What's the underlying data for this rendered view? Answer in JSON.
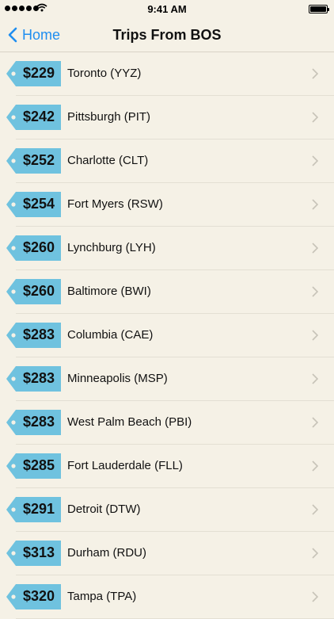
{
  "status_bar": {
    "time": "9:41 AM",
    "signal_icon": "signal-dots-icon",
    "wifi_icon": "wifi-icon",
    "battery_icon": "battery-icon",
    "battery_level": 1.0
  },
  "nav": {
    "back_label": "Home",
    "title": "Trips From BOS",
    "accent_color": "#1f8ef0"
  },
  "tag_color": "#6fc2df",
  "trips": [
    {
      "price": "$229",
      "destination": "Toronto (YYZ)"
    },
    {
      "price": "$242",
      "destination": "Pittsburgh (PIT)"
    },
    {
      "price": "$252",
      "destination": "Charlotte (CLT)"
    },
    {
      "price": "$254",
      "destination": "Fort Myers (RSW)"
    },
    {
      "price": "$260",
      "destination": "Lynchburg (LYH)"
    },
    {
      "price": "$260",
      "destination": "Baltimore (BWI)"
    },
    {
      "price": "$283",
      "destination": "Columbia (CAE)"
    },
    {
      "price": "$283",
      "destination": "Minneapolis (MSP)"
    },
    {
      "price": "$283",
      "destination": "West Palm Beach (PBI)"
    },
    {
      "price": "$285",
      "destination": "Fort Lauderdale (FLL)"
    },
    {
      "price": "$291",
      "destination": "Detroit (DTW)"
    },
    {
      "price": "$313",
      "destination": "Durham (RDU)"
    },
    {
      "price": "$320",
      "destination": "Tampa (TPA)"
    }
  ]
}
